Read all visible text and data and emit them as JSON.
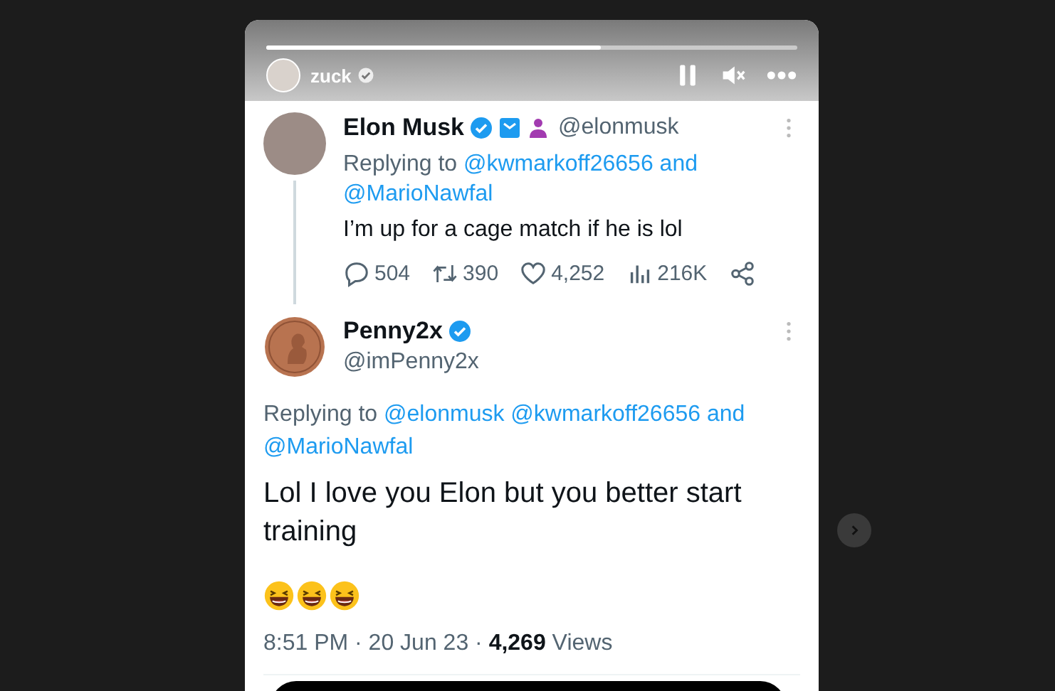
{
  "story": {
    "progress": {
      "level": 0.63
    },
    "user": "zuck",
    "verified": true,
    "controls": [
      {
        "kind": "pause"
      },
      {
        "kind": "mute"
      },
      {
        "kind": "more"
      }
    ]
  },
  "tweets": [
    {
      "author": "Elon Musk",
      "verified": true,
      "affiliate": true,
      "handle": "@elonmusk",
      "replying": {
        "label": "Replying to",
        "mentions": "@kwmarkoff26656 and @MarioNawfal"
      },
      "text": "I’m up for a cage match if he is lol",
      "stats": [
        {
          "kind": "reply",
          "count": "504"
        },
        {
          "kind": "retweet",
          "count": "390"
        },
        {
          "kind": "like",
          "count": "4,252"
        },
        {
          "kind": "views",
          "count": "216K"
        },
        {
          "kind": "share"
        }
      ]
    },
    {
      "author": "Penny2x",
      "verified": true,
      "affiliate": false,
      "handle": "@imPenny2x",
      "replying": {
        "label": "Replying to",
        "mentions": "@elonmusk @kwmarkoff26656 and @MarioNawfal"
      },
      "text": "Lol I love you Elon but you better start training",
      "timestamp": "8:51 PM · 20 Jun 23 · **4,269** Views"
    }
  ]
}
